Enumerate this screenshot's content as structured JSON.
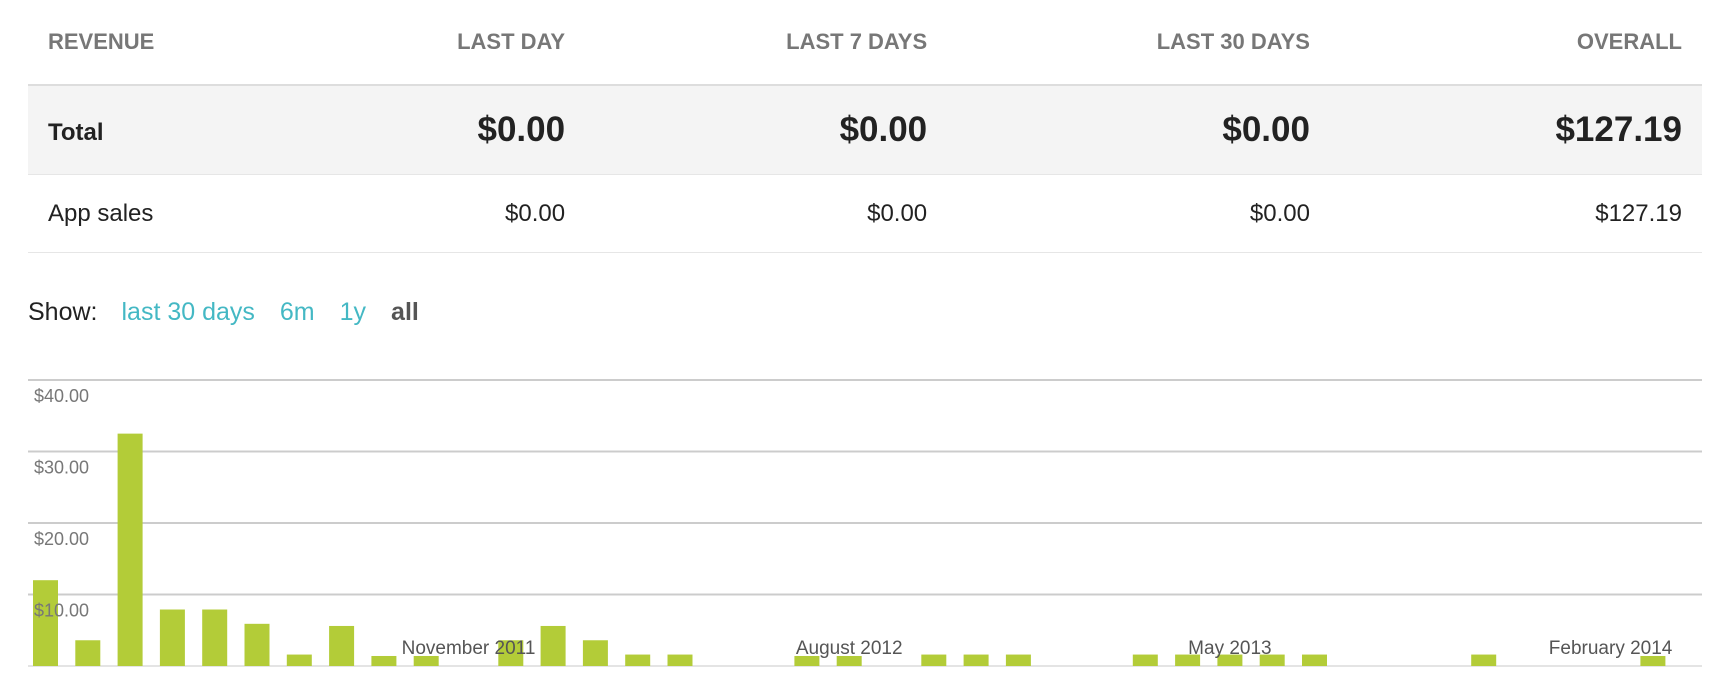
{
  "revenue_table": {
    "headers": [
      "REVENUE",
      "LAST DAY",
      "LAST 7 DAYS",
      "LAST 30 DAYS",
      "OVERALL"
    ],
    "rows": [
      {
        "label": "Total",
        "values": [
          "$0.00",
          "$0.00",
          "$0.00",
          "$127.19"
        ]
      },
      {
        "label": "App sales",
        "values": [
          "$0.00",
          "$0.00",
          "$0.00",
          "$127.19"
        ]
      }
    ]
  },
  "show_filter": {
    "label": "Show:",
    "options": [
      "last 30 days",
      "6m",
      "1y",
      "all"
    ],
    "selected": "all"
  },
  "colors": {
    "bar": "#b3cc38",
    "link": "#44b8c4",
    "grid": "#cccccc",
    "total_row_bg": "#f4f4f4"
  },
  "chart_data": {
    "type": "bar",
    "y_ticks": [
      "$10.00",
      "$20.00",
      "$30.00",
      "$40.00"
    ],
    "ylim": [
      0,
      40
    ],
    "x_labels": [
      "November 2011",
      "August 2012",
      "May 2013",
      "February 2014"
    ],
    "categories": [
      "2011-01",
      "2011-02",
      "2011-03",
      "2011-04",
      "2011-05",
      "2011-06",
      "2011-07",
      "2011-08",
      "2011-09",
      "2011-10",
      "2011-11",
      "2011-12",
      "2012-01",
      "2012-02",
      "2012-03",
      "2012-04",
      "2012-05",
      "2012-06",
      "2012-07",
      "2012-08",
      "2012-09",
      "2012-10",
      "2012-11",
      "2012-12",
      "2013-01",
      "2013-02",
      "2013-03",
      "2013-04",
      "2013-05",
      "2013-06",
      "2013-07",
      "2013-08",
      "2013-09",
      "2013-10",
      "2013-11",
      "2013-12",
      "2014-01",
      "2014-02",
      "2014-03"
    ],
    "values": [
      12,
      3.6,
      32.5,
      7.9,
      7.9,
      5.9,
      1.6,
      5.6,
      1.4,
      1.4,
      0,
      3.6,
      5.6,
      3.6,
      1.6,
      1.6,
      0,
      0,
      1.4,
      1.4,
      0,
      1.6,
      1.6,
      1.6,
      0,
      0,
      1.6,
      1.6,
      1.6,
      1.6,
      1.6,
      0,
      0,
      0,
      1.6,
      0,
      0,
      0,
      1.4
    ],
    "grid": true
  }
}
